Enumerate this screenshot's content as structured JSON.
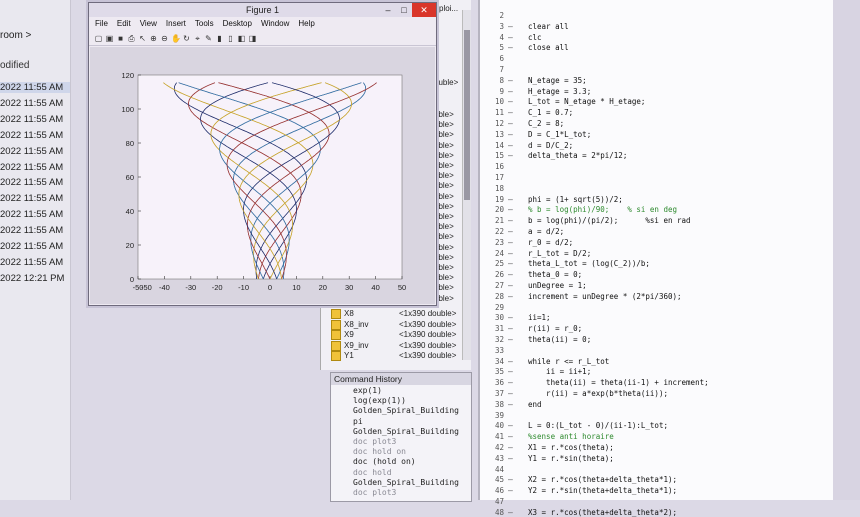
{
  "explorer": {
    "breadcrumb": "room >",
    "column_header": "odified",
    "rows": [
      "2022 11:55 AM",
      "2022 11:55 AM",
      "2022 11:55 AM",
      "2022 11:55 AM",
      "2022 11:55 AM",
      "2022 11:55 AM",
      "2022 11:55 AM",
      "2022 11:55 AM",
      "2022 11:55 AM",
      "2022 11:55 AM",
      "2022 11:55 AM",
      "2022 11:55 AM",
      "2022 12:21 PM"
    ]
  },
  "workspace": {
    "top_fragment": "ploi...",
    "values": [
      "ouble>",
      "uble>",
      "uble>",
      "uble>",
      "uble>",
      "uble>",
      "uble>",
      "uble>",
      "uble>",
      "uble>",
      "uble>",
      "uble>",
      "uble>",
      "uble>",
      "uble>",
      "uble>",
      "uble>",
      "uble>",
      "uble>",
      "uble>"
    ],
    "vars": [
      {
        "name": "X8",
        "value": "<1x390 double>"
      },
      {
        "name": "X8_inv",
        "value": "<1x390 double>"
      },
      {
        "name": "X9",
        "value": "<1x390 double>"
      },
      {
        "name": "X9_inv",
        "value": "<1x390 double>"
      },
      {
        "name": "Y1",
        "value": "<1x390 double>"
      }
    ]
  },
  "command_history": {
    "title": "Command History",
    "entries": [
      {
        "text": "exp(1)",
        "dim": false
      },
      {
        "text": "log(exp(1))",
        "dim": false
      },
      {
        "text": "Golden_Spiral_Building",
        "dim": false
      },
      {
        "text": "pi",
        "dim": false
      },
      {
        "text": "Golden_Spiral_Building",
        "dim": false
      },
      {
        "text": "doc plot3",
        "dim": true
      },
      {
        "text": "doc hold on",
        "dim": true
      },
      {
        "text": "doc (hold on)",
        "dim": false
      },
      {
        "text": "doc hold",
        "dim": true
      },
      {
        "text": "Golden_Spiral_Building",
        "dim": false
      },
      {
        "text": "doc plot3",
        "dim": true
      }
    ]
  },
  "editor": {
    "lines": [
      {
        "n": "2",
        "code": "",
        "cmt": false
      },
      {
        "n": "3",
        "code": "clear all",
        "cmt": false
      },
      {
        "n": "4",
        "code": "clc",
        "cmt": false
      },
      {
        "n": "5",
        "code": "close all",
        "cmt": false
      },
      {
        "n": "6",
        "code": "",
        "cmt": false
      },
      {
        "n": "7",
        "code": "",
        "cmt": false
      },
      {
        "n": "8",
        "code": "N_etage = 35;",
        "cmt": false
      },
      {
        "n": "9",
        "code": "H_etage = 3.3;",
        "cmt": false
      },
      {
        "n": "10",
        "code": "L_tot = N_etage * H_etage;",
        "cmt": false
      },
      {
        "n": "11",
        "code": "C_1 = 0.7;",
        "cmt": false
      },
      {
        "n": "12",
        "code": "C_2 = 8;",
        "cmt": false
      },
      {
        "n": "13",
        "code": "D = C_1*L_tot;",
        "cmt": false
      },
      {
        "n": "14",
        "code": "d = D/C_2;",
        "cmt": false
      },
      {
        "n": "15",
        "code": "delta_theta = 2*pi/12;",
        "cmt": false
      },
      {
        "n": "16",
        "code": "",
        "cmt": false
      },
      {
        "n": "17",
        "code": "",
        "cmt": false
      },
      {
        "n": "18",
        "code": "",
        "cmt": false
      },
      {
        "n": "19",
        "code": "phi = (1+ sqrt(5))/2;",
        "cmt": false
      },
      {
        "n": "20",
        "code": "% b = log(phi)/90;    % si en deg",
        "cmt": true
      },
      {
        "n": "21",
        "code": "b = log(phi)/(pi/2);      %si en rad",
        "cmt": false
      },
      {
        "n": "22",
        "code": "a = d/2;",
        "cmt": false
      },
      {
        "n": "23",
        "code": "r_0 = d/2;",
        "cmt": false
      },
      {
        "n": "24",
        "code": "r_L_tot = D/2;",
        "cmt": false
      },
      {
        "n": "25",
        "code": "theta_L_tot = (log(C_2))/b;",
        "cmt": false
      },
      {
        "n": "26",
        "code": "theta_0 = 0;",
        "cmt": false
      },
      {
        "n": "27",
        "code": "unDegree = 1;",
        "cmt": false
      },
      {
        "n": "28",
        "code": "increment = unDegree * (2*pi/360);",
        "cmt": false
      },
      {
        "n": "29",
        "code": "",
        "cmt": false
      },
      {
        "n": "30",
        "code": "ii=1;",
        "cmt": false
      },
      {
        "n": "31",
        "code": "r(ii) = r_0;",
        "cmt": false
      },
      {
        "n": "32",
        "code": "theta(ii) = 0;",
        "cmt": false
      },
      {
        "n": "33",
        "code": "",
        "cmt": false
      },
      {
        "n": "34",
        "code": "while r <= r_L_tot",
        "cmt": false
      },
      {
        "n": "35",
        "code": "    ii = ii+1;",
        "cmt": false
      },
      {
        "n": "36",
        "code": "    theta(ii) = theta(ii-1) + increment;",
        "cmt": false
      },
      {
        "n": "37",
        "code": "    r(ii) = a*exp(b*theta(ii));",
        "cmt": false
      },
      {
        "n": "38",
        "code": "end",
        "cmt": false
      },
      {
        "n": "39",
        "code": "",
        "cmt": false
      },
      {
        "n": "40",
        "code": "L = 0:(L_tot - 0)/(ii-1):L_tot;",
        "cmt": false
      },
      {
        "n": "41",
        "code": "%sense anti horaire",
        "cmt": true
      },
      {
        "n": "42",
        "code": "X1 = r.*cos(theta);",
        "cmt": false
      },
      {
        "n": "43",
        "code": "Y1 = r.*sin(theta);",
        "cmt": false
      },
      {
        "n": "44",
        "code": "",
        "cmt": false
      },
      {
        "n": "45",
        "code": "X2 = r.*cos(theta+delta_theta*1);",
        "cmt": false
      },
      {
        "n": "46",
        "code": "Y2 = r.*sin(theta+delta_theta*1);",
        "cmt": false
      },
      {
        "n": "47",
        "code": "",
        "cmt": false
      },
      {
        "n": "48",
        "code": "X3 = r.*cos(theta+delta_theta*2);",
        "cmt": false
      }
    ]
  },
  "figure": {
    "title": "Figure 1",
    "menu": [
      "File",
      "Edit",
      "View",
      "Insert",
      "Tools",
      "Desktop",
      "Window",
      "Help"
    ],
    "toolbar_icons": [
      "new-icon",
      "open-icon",
      "save-icon",
      "print-icon",
      "pointer-icon",
      "zoom-in-icon",
      "zoom-out-icon",
      "pan-icon",
      "rotate-icon",
      "datacursor-icon",
      "brush-icon",
      "colorbar-icon",
      "legend-icon",
      "hide-tools-icon",
      "show-tools-icon"
    ],
    "toolbar_glyphs": [
      "▢",
      "▣",
      "■",
      "⎙",
      "↖",
      "⊕",
      "⊖",
      "✋",
      "↻",
      "⌖",
      "✎",
      "▮",
      "▯",
      "◧",
      "◨"
    ]
  },
  "chart_data": {
    "type": "line",
    "view": "3D (side)",
    "xlim": [
      -50,
      50
    ],
    "ylim": [
      0,
      120
    ],
    "xticks": [
      "-50",
      "-40",
      "-30",
      "-20",
      "-10",
      "0",
      "10",
      "20",
      "30",
      "40",
      "50"
    ],
    "yticks": [
      "0",
      "20",
      "40",
      "60",
      "80",
      "100",
      "120"
    ],
    "x_tick_extra": "-50",
    "height_total": 115.5,
    "radius_top": 40.4,
    "radius_bottom": 5.05,
    "n_spirals": 12,
    "colors": [
      "#2a2a66",
      "#c8a632",
      "#3a7fb0",
      "#9a3a3a"
    ]
  }
}
